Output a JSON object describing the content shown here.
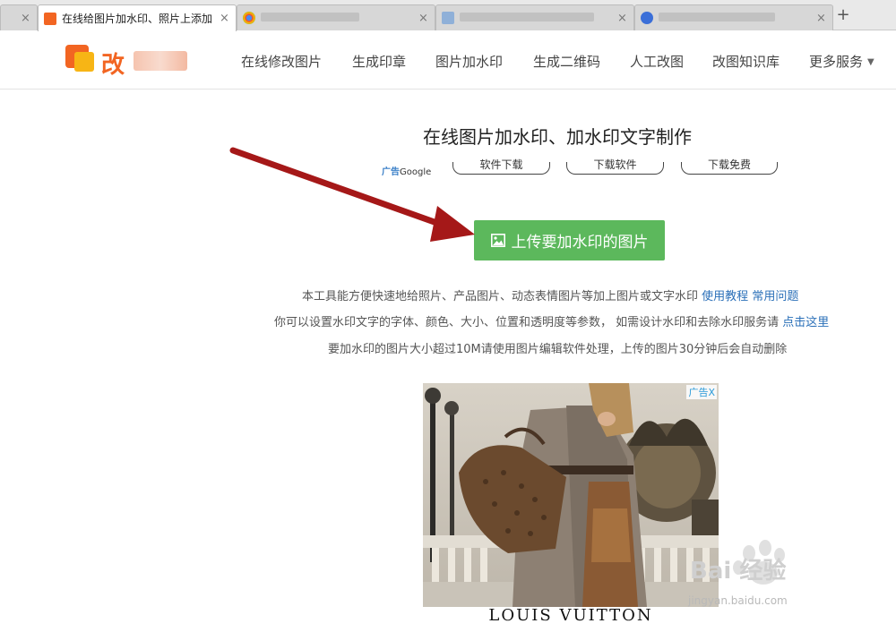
{
  "browser": {
    "tabs": [
      {
        "title": "",
        "active": false
      },
      {
        "title": "在线给图片加水印、照片上添加",
        "active": true
      },
      {
        "title": "",
        "active": false
      },
      {
        "title": "",
        "active": false
      },
      {
        "title": "",
        "active": false
      }
    ],
    "new_tab": "+"
  },
  "site": {
    "logo_text": "改",
    "nav": [
      "在线修改图片",
      "生成印章",
      "图片加水印",
      "生成二维码",
      "人工改图",
      "改图知识库",
      "更多服务"
    ]
  },
  "main": {
    "title": "在线图片加水印、加水印文字制作",
    "ad_label": "广告",
    "ad_label_brand": "Google",
    "ad_links": [
      "软件下载",
      "下载软件",
      "下载免费"
    ],
    "upload_button": "上传要加水印的图片",
    "desc_line1": "本工具能方便快速地给照片、产品图片、动态表情图片等加上图片或文字水印",
    "desc_link1": "使用教程",
    "desc_link2": "常用问题",
    "desc_line2": "你可以设置水印文字的字体、颜色、大小、位置和透明度等参数， 如需设计水印和去除水印服务请",
    "desc_link3": "点击这里",
    "desc_line3": "要加水印的图片大小超过10M请使用图片编辑软件处理，上传的图片30分钟后会自动删除"
  },
  "advert": {
    "close": "广告X",
    "brand": "LOUIS VUITTON"
  },
  "watermark": {
    "text": "Bai 经验",
    "site": "jingyan.baidu.com"
  },
  "colors": {
    "upload_green": "#5cb85c",
    "arrow_red": "#a51818",
    "link_blue": "#2a6fb8",
    "logo_orange": "#f26522"
  }
}
